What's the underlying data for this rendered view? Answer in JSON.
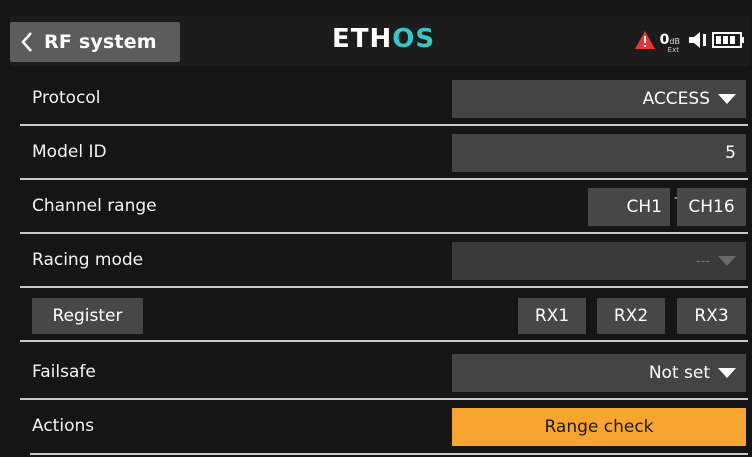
{
  "header": {
    "back_icon": "chevron-left-icon",
    "title": "RF system",
    "logo_main": "ETH",
    "logo_accent": "OS",
    "status": {
      "alert_icon": "warning-icon",
      "db_value": "0",
      "db_unit": "dB",
      "db_sub": "Ext",
      "speaker_icon": "speaker-icon",
      "battery_icon": "battery-icon"
    }
  },
  "rows": {
    "protocol": {
      "label": "Protocol",
      "value": "ACCESS"
    },
    "model_id": {
      "label": "Model ID",
      "value": "5"
    },
    "channel_range": {
      "label": "Channel range",
      "start": "CH1",
      "separator": "-",
      "end": "CH16"
    },
    "racing_mode": {
      "label": "Racing mode",
      "value": "---"
    },
    "register": {
      "button": "Register",
      "rx1": "RX1",
      "rx2": "RX2",
      "rx3": "RX3"
    },
    "failsafe": {
      "label": "Failsafe",
      "value": "Not set"
    },
    "actions": {
      "label": "Actions",
      "button": "Range check"
    }
  },
  "colors": {
    "accent_orange": "#f7a530",
    "logo_teal": "#36c6c6",
    "alert_red": "#e53935"
  }
}
